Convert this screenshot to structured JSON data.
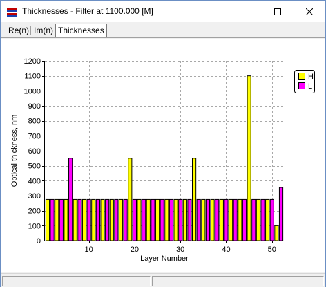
{
  "window": {
    "title": "Thicknesses - Filter at 1100.000 [M]",
    "icon": "filter-app-icon",
    "controls": [
      "minimize",
      "maximize",
      "close"
    ]
  },
  "tabs": [
    {
      "label": "Re(n)",
      "active": false
    },
    {
      "label": "Im(n)",
      "active": false
    },
    {
      "label": "Thicknesses",
      "active": true
    }
  ],
  "chart_data": {
    "type": "bar",
    "xlabel": "Layer Number",
    "ylabel": "Optical thickness, nm",
    "ylim": [
      0,
      1200
    ],
    "yticks": [
      0,
      100,
      200,
      300,
      400,
      500,
      600,
      700,
      800,
      900,
      1000,
      1100,
      1200
    ],
    "xticks": [
      10,
      20,
      30,
      40,
      50
    ],
    "grid": true,
    "legend_position": "top-right",
    "legend": [
      {
        "label": "H",
        "color": "#ffff00"
      },
      {
        "label": "L",
        "color": "#ff00ff"
      }
    ],
    "layers": [
      1,
      2,
      3,
      4,
      5,
      6,
      7,
      8,
      9,
      10,
      11,
      12,
      13,
      14,
      15,
      16,
      17,
      18,
      19,
      20,
      21,
      22,
      23,
      24,
      25,
      26,
      27,
      28,
      29,
      30,
      31,
      32,
      33,
      34,
      35,
      36,
      37,
      38,
      39,
      40,
      41,
      42,
      43,
      44,
      45,
      46,
      47,
      48,
      49,
      50,
      51,
      52
    ],
    "materials": [
      "H",
      "L",
      "H",
      "L",
      "H",
      "L",
      "H",
      "L",
      "H",
      "L",
      "H",
      "L",
      "H",
      "L",
      "H",
      "L",
      "H",
      "L",
      "H",
      "L",
      "H",
      "L",
      "H",
      "L",
      "H",
      "L",
      "H",
      "L",
      "H",
      "L",
      "H",
      "L",
      "H",
      "L",
      "H",
      "L",
      "H",
      "L",
      "H",
      "L",
      "H",
      "L",
      "H",
      "L",
      "H",
      "L",
      "H",
      "L",
      "H",
      "L",
      "H",
      "L"
    ],
    "values": [
      275,
      275,
      275,
      275,
      275,
      550,
      275,
      275,
      275,
      275,
      275,
      275,
      275,
      275,
      275,
      275,
      275,
      275,
      550,
      275,
      275,
      275,
      275,
      275,
      275,
      275,
      275,
      275,
      275,
      275,
      275,
      275,
      550,
      275,
      275,
      275,
      275,
      275,
      275,
      275,
      275,
      275,
      275,
      275,
      1100,
      275,
      275,
      275,
      275,
      275,
      100,
      355
    ]
  }
}
